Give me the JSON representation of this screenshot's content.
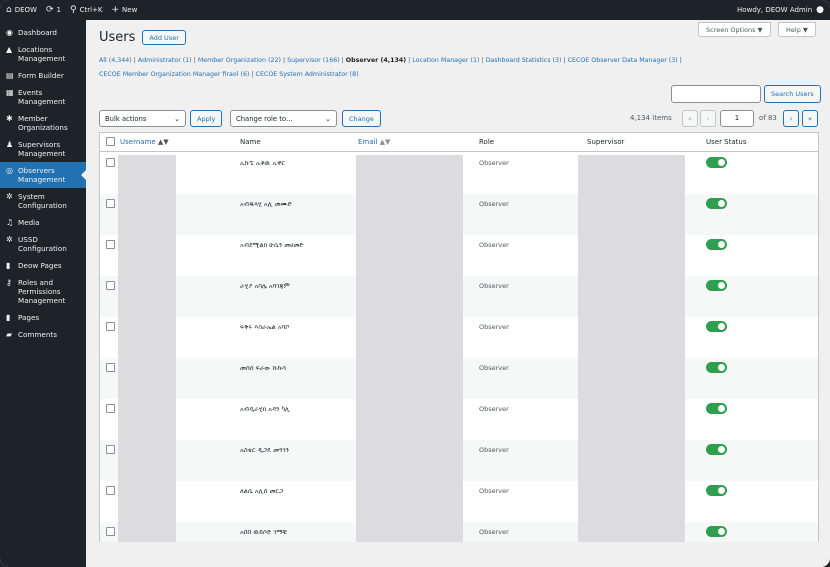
{
  "adminbar": {
    "site": "DEOW",
    "updates": "1",
    "search": "Ctrl+K",
    "new": "New",
    "greeting": "Howdy, DEOW Admin",
    "icons": [
      "home-icon",
      "refresh-icon",
      "search-icon",
      "plus-icon",
      "user-icon"
    ]
  },
  "sidebar": {
    "items": [
      {
        "label": "Dashboard",
        "icon": "dashboard-icon"
      },
      {
        "label": "Locations Management",
        "icon": "location-icon"
      },
      {
        "label": "Form Builder",
        "icon": "form-icon"
      },
      {
        "label": "Events Management",
        "icon": "calendar-icon"
      },
      {
        "label": "Member Organizations",
        "icon": "organization-icon"
      },
      {
        "label": "Supervisors Management",
        "icon": "person-icon"
      },
      {
        "label": "Observers Management",
        "icon": "eye-icon",
        "active": true
      },
      {
        "label": "System Configuration",
        "icon": "settings-icon"
      },
      {
        "label": "Media",
        "icon": "media-icon"
      },
      {
        "label": "USSD Configuration",
        "icon": "settings-icon"
      },
      {
        "label": "Deow Pages",
        "icon": "pages-icon"
      },
      {
        "label": "Roles and Permissions Management",
        "icon": "key-icon"
      },
      {
        "label": "Pages",
        "icon": "pages-icon"
      },
      {
        "label": "Comments",
        "icon": "comment-icon"
      }
    ]
  },
  "header": {
    "title": "Users",
    "add_user": "Add User",
    "screen_options": "Screen Options ▼",
    "help": "Help ▼"
  },
  "filters": {
    "all": "All (4,344)",
    "administrator": "Administrator (1)",
    "member_org": "Member Organization (22)",
    "supervisor": "Supervisor (166)",
    "observer": "Observer (4,134)",
    "location_manager": "Location Manager (1)",
    "dashboard_stats": "Dashboard Statistics (3)",
    "observer_data_manager": "CECOE Observer Data Manager (3)",
    "member_org_manager": "CECOE Member Organization Manager firaol (6)",
    "system_admin": "CECOE System Administrator (8)"
  },
  "search": {
    "value": "",
    "button": "Search Users"
  },
  "bulk": {
    "bulk_actions": "Bulk actions",
    "apply": "Apply",
    "change_role": "Change role to…",
    "change": "Change"
  },
  "pagination": {
    "items": "4,134 items",
    "first": "«",
    "prev": "‹",
    "current": "1",
    "of": "of 83",
    "next": "›",
    "last": "»"
  },
  "table": {
    "columns": {
      "username": "Username",
      "name": "Name",
      "email": "Email",
      "role": "Role",
      "supervisor": "Supervisor",
      "status": "User Status"
    },
    "sort_indicator": "▲▼",
    "rows": [
      {
        "name": "ኡኩኚ ኡቶዉ ኡዋር",
        "role": "Observer",
        "active": true
      },
      {
        "name": "አብዱላሂ አሊ መሙድ",
        "role": "Observer",
        "active": true
      },
      {
        "name": "አብደሚልክ ሁሴን መሀመድ",
        "role": "Observer",
        "active": true
      },
      {
        "name": "ራሂያ አባሌ አባገጃም",
        "role": "Observer",
        "active": true
      },
      {
        "name": "ፍቅሩ እስራኤል አባቦ",
        "role": "Observer",
        "active": true
      },
      {
        "name": "መሰሰ ፍራው ኩኩሳ",
        "role": "Observer",
        "active": true
      },
      {
        "name": "አብዲራሂክ አዳን ካሊ",
        "role": "Observer",
        "active": true
      },
      {
        "name": "አስቴር ዲጋዴ መንገን",
        "role": "Observer",
        "active": true
      },
      {
        "name": "ለልሴ አሊሰ መርጋ",
        "role": "Observer",
        "active": true
      },
      {
        "name": "አበበ ዉይሶድ ገማቹ",
        "role": "Observer",
        "active": true
      }
    ]
  },
  "colors": {
    "accent": "#2271b1",
    "toggle_on": "#2e9e4f",
    "sidebar_bg": "#1d2327"
  }
}
